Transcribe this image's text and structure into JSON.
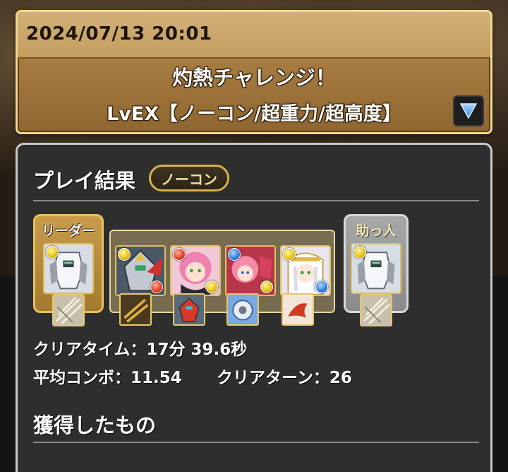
{
  "header": {
    "date": "2024/07/13 20:01",
    "title": "灼熱チャレンジ！",
    "subtitle": "LvEX【ノーコン/超重力/超高度】"
  },
  "result": {
    "title": "プレイ結果",
    "badge": "ノーコン",
    "leader_label": "リーダー",
    "helper_label": "助っ人",
    "team": [
      {
        "name": "leader",
        "main_attr": "yellow",
        "sub_attr": "none"
      },
      {
        "name": "sub-1",
        "main_attr": "yellow",
        "sub_attr": "red"
      },
      {
        "name": "sub-2",
        "main_attr": "red",
        "sub_attr": "yellow"
      },
      {
        "name": "sub-3",
        "main_attr": "blue",
        "sub_attr": "yellow"
      },
      {
        "name": "sub-4",
        "main_attr": "yellow",
        "sub_attr": "blue"
      },
      {
        "name": "helper",
        "main_attr": "yellow",
        "sub_attr": "none"
      }
    ],
    "clear_time": "クリアタイム：17分 39.6秒",
    "avg_combo": "平均コンボ：11.54",
    "clear_turns": "クリアターン：26",
    "obtained_title": "獲得したもの"
  },
  "colors": {
    "gold_border": "#e6c262",
    "panel_bg": "#2e2e2e",
    "header_bg": "#a57a40"
  }
}
